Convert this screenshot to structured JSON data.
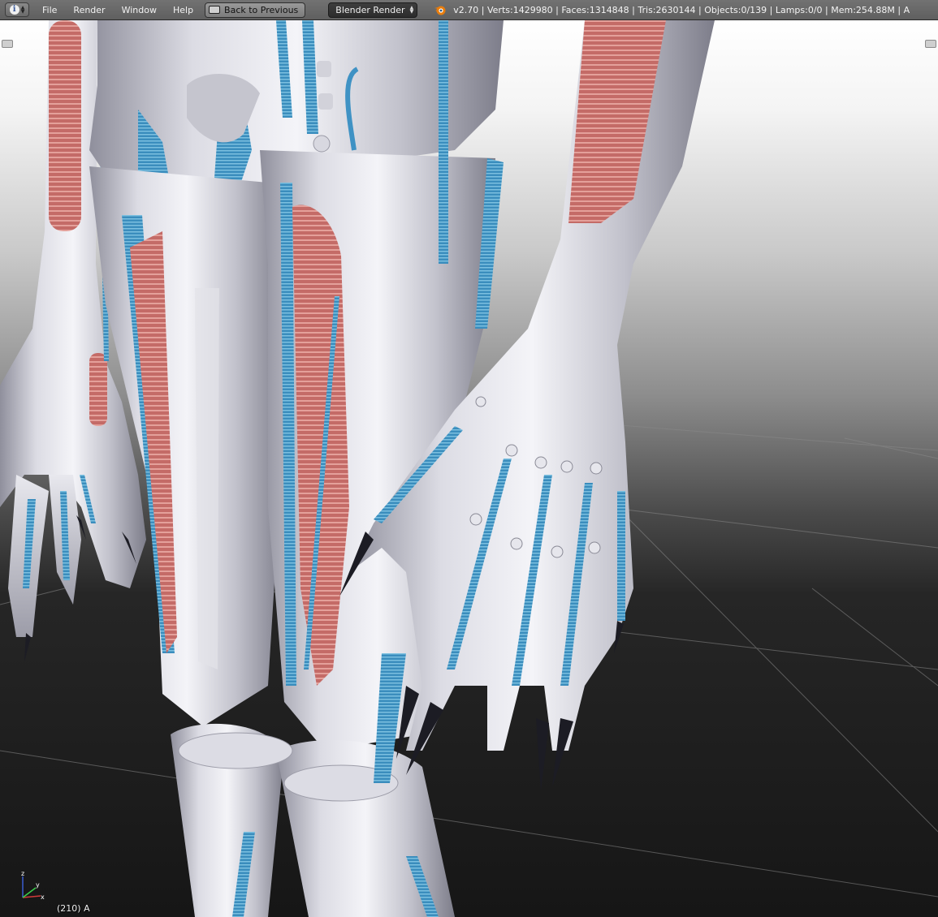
{
  "header": {
    "menu": [
      "File",
      "Render",
      "Window",
      "Help"
    ],
    "back_label": "Back to Previous",
    "render_engine": "Blender Render",
    "stats": "v2.70 | Verts:1429980 | Faces:1314848 | Tris:2630144 | Objects:0/139 | Lamps:0/0 | Mem:254.88M | A"
  },
  "viewport": {
    "frame_label": "(210) A",
    "axis_labels": {
      "x": "x",
      "y": "y",
      "z": "z"
    }
  },
  "colors": {
    "header_bg": "#6b6b6b",
    "accent_blue": "#3f92c4",
    "muscle_red": "#c86a66",
    "chrome": "#c9c9d2"
  }
}
